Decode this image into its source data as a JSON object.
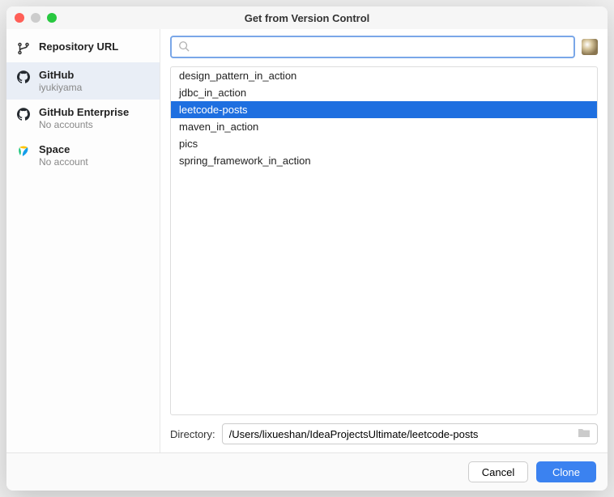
{
  "title": "Get from Version Control",
  "sidebar": {
    "items": [
      {
        "label": "Repository URL",
        "sub": ""
      },
      {
        "label": "GitHub",
        "sub": "iyukiyama"
      },
      {
        "label": "GitHub Enterprise",
        "sub": "No accounts"
      },
      {
        "label": "Space",
        "sub": "No account"
      }
    ]
  },
  "search": {
    "value": ""
  },
  "repos": [
    "design_pattern_in_action",
    "jdbc_in_action",
    "leetcode-posts",
    "maven_in_action",
    "pics",
    "spring_framework_in_action"
  ],
  "selected_repo_index": 2,
  "directory": {
    "label": "Directory:",
    "value": "/Users/lixueshan/IdeaProjectsUltimate/leetcode-posts"
  },
  "buttons": {
    "cancel": "Cancel",
    "clone": "Clone"
  }
}
